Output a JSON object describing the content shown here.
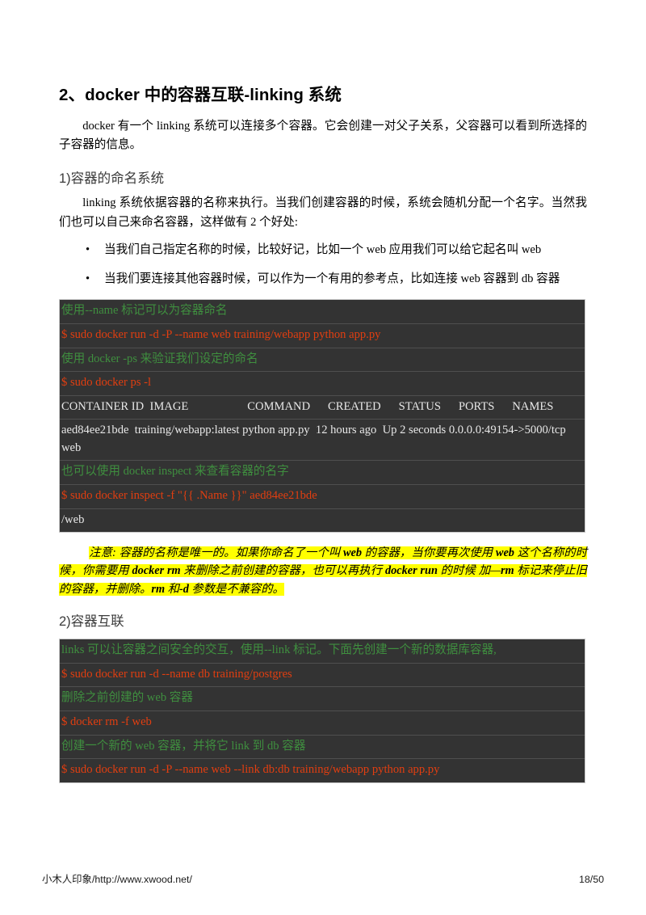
{
  "document": {
    "title": "2、docker 中的容器互联-linking 系统",
    "intro": "docker 有一个 linking 系统可以连接多个容器。它会创建一对父子关系，父容器可以看到所选择的子容器的信息。",
    "section1": {
      "heading": "1)容器的命名系统",
      "para": "linking 系统依据容器的名称来执行。当我们创建容器的时候，系统会随机分配一个名字。当然我们也可以自己来命名容器，这样做有 2 个好处:",
      "bullet_marker": "•",
      "bullets": [
        "当我们自己指定名称的时候，比较好记，比如一个 web 应用我们可以给它起名叫 web",
        "当我们要连接其他容器时候，可以作为一个有用的参考点，比如连接 web 容器到 db 容器"
      ],
      "code_block": [
        {
          "kind": "comment",
          "text": "使用--name 标记可以为容器命名"
        },
        {
          "kind": "cmd",
          "text": "$ sudo docker run -d -P --name web training/webapp python app.py"
        },
        {
          "kind": "comment",
          "text": "使用 docker -ps 来验证我们设定的命名"
        },
        {
          "kind": "cmd",
          "text": "$ sudo docker ps -l"
        },
        {
          "kind": "out",
          "text": "CONTAINER ID  IMAGE                    COMMAND      CREATED      STATUS      PORTS      NAMES"
        },
        {
          "kind": "out",
          "text": "aed84ee21bde  training/webapp:latest python app.py  12 hours ago  Up 2 seconds 0.0.0.0:49154->5000/tcp  web"
        },
        {
          "kind": "comment",
          "text": "也可以使用 docker inspect 来查看容器的名字"
        },
        {
          "kind": "cmd",
          "text": "$ sudo docker inspect -f \"{{ .Name }}\" aed84ee21bde"
        },
        {
          "kind": "out",
          "text": "/web"
        }
      ],
      "note_segments": [
        {
          "text": "注意: 容器的名称是唯一的。如果你命名了一个叫 ",
          "bold": false
        },
        {
          "text": "web",
          "bold": true
        },
        {
          "text": " 的容器，当你要再次使用 ",
          "bold": false
        },
        {
          "text": "web",
          "bold": true
        },
        {
          "text": " 这个名称的时候，你需要用 ",
          "bold": false
        },
        {
          "text": "docker rm",
          "bold": true
        },
        {
          "text": " 来删除之前创建的容器，也可以再执行 ",
          "bold": false
        },
        {
          "text": "docker run",
          "bold": true
        },
        {
          "text": " 的时候 加—",
          "bold": false
        },
        {
          "text": "rm",
          "bold": true
        },
        {
          "text": " 标记来停止旧的容器，并删除。",
          "bold": false
        },
        {
          "text": "rm",
          "bold": true
        },
        {
          "text": " 和",
          "bold": false
        },
        {
          "text": "-d",
          "bold": true
        },
        {
          "text": " 参数是不兼容的。",
          "bold": false
        }
      ]
    },
    "section2": {
      "heading": "2)容器互联",
      "code_block": [
        {
          "kind": "comment",
          "text": "links 可以让容器之间安全的交互，使用--link 标记。下面先创建一个新的数据库容器,"
        },
        {
          "kind": "cmd",
          "text": "$ sudo docker run -d --name db training/postgres"
        },
        {
          "kind": "comment",
          "text": "删除之前创建的 web 容器"
        },
        {
          "kind": "cmd",
          "text": "$ docker rm -f web"
        },
        {
          "kind": "comment",
          "text": "创建一个新的 web 容器，并将它 link 到 db 容器"
        },
        {
          "kind": "cmd",
          "text": "$ sudo docker run -d -P --name web --link db:db training/webapp python app.py"
        }
      ]
    }
  },
  "footer": {
    "left": "小木人印象/http://www.xwood.net/",
    "right": "18/50"
  },
  "colors": {
    "code_background": "#333333",
    "comment_text": "#3f8f3f",
    "command_text": "#e23e10",
    "output_text": "#e8e8e8",
    "highlight": "#ffff00"
  }
}
